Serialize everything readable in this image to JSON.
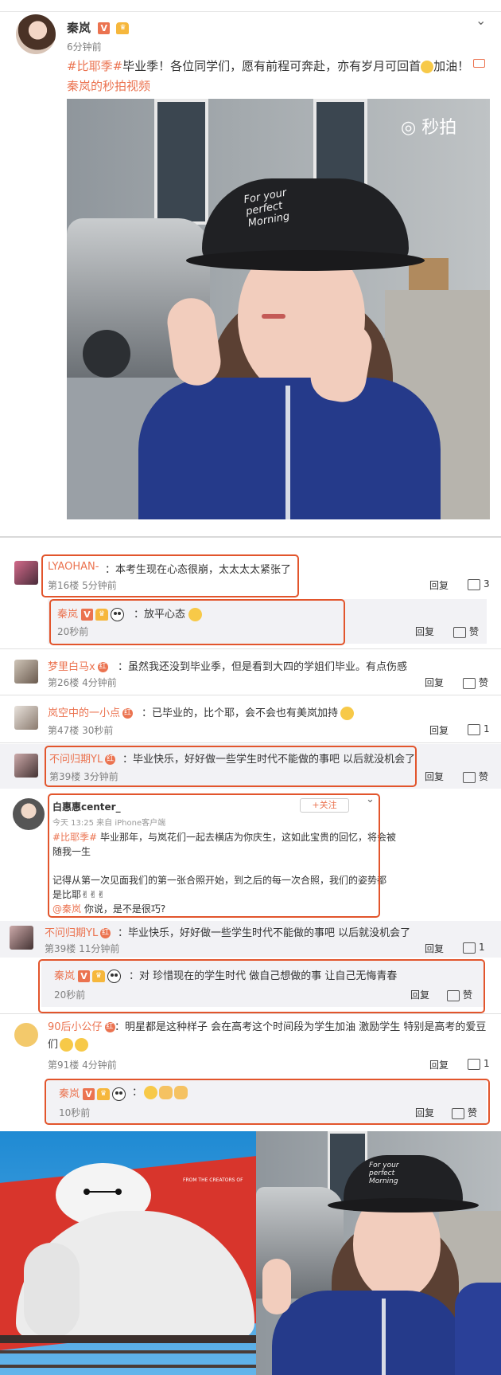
{
  "post": {
    "author": "秦岚",
    "time": "6分钟前",
    "text_hashtag": "#比耶季#",
    "text_body": "毕业季！各位同学们，愿有前程可奔赴，亦有岁月可回首",
    "text_end": "加油！",
    "video_link": "秦岚的秒拍视频",
    "watermark": "秒拍",
    "hat_text_1": "For your",
    "hat_text_2": "perfect",
    "hat_text_3": "Morning"
  },
  "comments": [
    {
      "name": "LYAOHAN-",
      "text": "：本考生现在心态很崩，太太太太紧张了",
      "meta": "第16楼 5分钟前",
      "reply": "回复",
      "likes": "3"
    },
    {
      "name": "秦岚",
      "text": "：放平心态",
      "meta": "20秒前",
      "reply": "回复",
      "likes": "赞"
    },
    {
      "name": "梦里白马x",
      "text": "：虽然我还没到毕业季，但是看到大四的学姐们毕业。有点伤感",
      "meta": "第26楼 4分钟前",
      "reply": "回复",
      "likes": "赞"
    },
    {
      "name": "岚空中的一小点",
      "text": "：已毕业的，比个耶，会不会也有美岚加持",
      "meta": "第47楼 30秒前",
      "reply": "回复",
      "likes": "1"
    },
    {
      "name": "不问归期YL",
      "text": "：毕业快乐，好好做一些学生时代不能做的事吧 以后就没机会了",
      "meta": "第39楼 3分钟前",
      "reply": "回复",
      "likes": "赞"
    }
  ],
  "embedded": {
    "name": "白惠惠center_",
    "follow": "+关注",
    "meta": "今天 13:25 来自 iPhone客户端",
    "hashtag": "#比耶季#",
    "line1": " 毕业那年，与岚花们一起去横店为你庆生，这如此宝贵的回忆，将会被",
    "line2": "随我一生",
    "line3": "记得从第一次见面我们的第一张合照开始，到之后的每一次合照，我们的姿势都",
    "line4": "是比耶✌✌✌",
    "mention": "@秦岚",
    "line5": " 你说，是不是很巧?"
  },
  "comments2": [
    {
      "name": "不问归期YL",
      "text": "：毕业快乐，好好做一些学生时代不能做的事吧 以后就没机会了",
      "meta": "第39楼 11分钟前",
      "reply": "回复",
      "likes": "1"
    },
    {
      "name": "秦岚",
      "text": "：对 珍惜现在的学生时代 做自己想做的事 让自己无悔青春",
      "meta": "20秒前",
      "reply": "回复",
      "likes": "赞"
    },
    {
      "name": "90后小公仔",
      "text1": "：明星都是这种样子 会在高考这个时间段为学生加油 激励学生  特别是高考的爱豆",
      "text2": "们",
      "meta": "第91楼 4分钟前",
      "reply": "回复",
      "likes": "1"
    },
    {
      "name": "秦岚",
      "text": "：",
      "meta": "10秒前",
      "reply": "回复",
      "likes": "赞"
    }
  ],
  "bottom": {
    "billboard_text": "FROM THE CREATORS OF",
    "hat_text_1": "For your",
    "hat_text_2": "perfect",
    "hat_text_3": "Morning"
  },
  "colors": {
    "accent": "#eb7350",
    "highlight": "#e2552c"
  }
}
